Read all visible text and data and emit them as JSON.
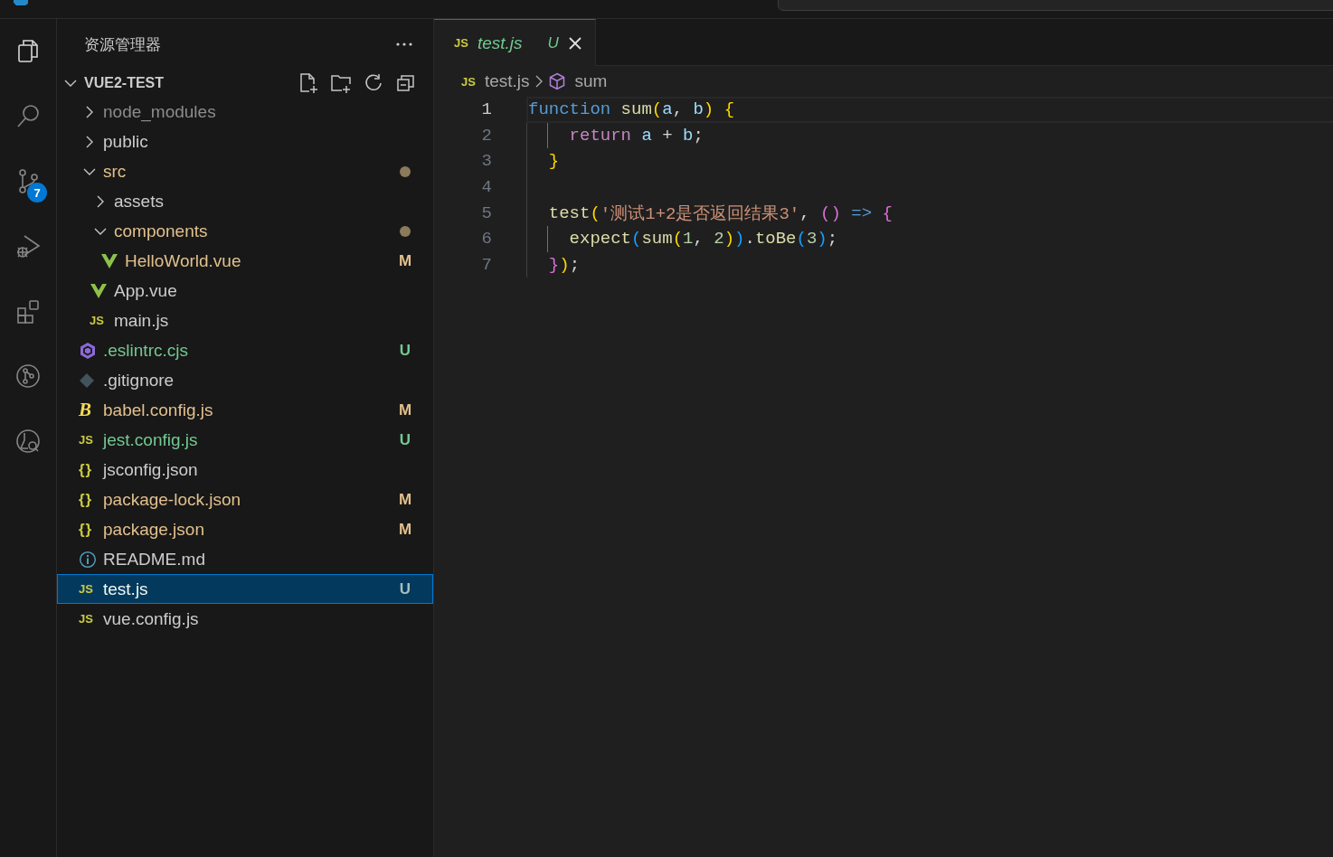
{
  "activity_bar": {
    "items": [
      {
        "kind": "explorer",
        "selected": true
      },
      {
        "kind": "search",
        "selected": false
      },
      {
        "kind": "source-control",
        "selected": false,
        "badge": "7"
      },
      {
        "kind": "run-debug",
        "selected": false
      },
      {
        "kind": "extensions",
        "selected": false
      },
      {
        "kind": "git-graph",
        "selected": false
      },
      {
        "kind": "testing",
        "selected": false
      }
    ]
  },
  "explorer": {
    "title": "资源管理器",
    "root": {
      "name": "VUE2-TEST",
      "expanded": true,
      "children": [
        {
          "name": "node_modules",
          "kind": "folder",
          "expanded": false,
          "ignored": true,
          "modified": false,
          "untracked": false,
          "selected": false
        },
        {
          "name": "public",
          "kind": "folder",
          "expanded": false,
          "ignored": false,
          "modified": false,
          "untracked": false,
          "selected": false
        },
        {
          "name": "src",
          "kind": "folder",
          "expanded": true,
          "ignored": false,
          "modified": true,
          "untracked": false,
          "selected": false,
          "children": [
            {
              "name": "assets",
              "kind": "folder",
              "expanded": false,
              "ignored": false,
              "modified": false,
              "untracked": false,
              "selected": false
            },
            {
              "name": "components",
              "kind": "folder",
              "expanded": true,
              "ignored": false,
              "modified": true,
              "untracked": false,
              "selected": false,
              "children": [
                {
                  "name": "HelloWorld.vue",
                  "kind": "file",
                  "icon": {
                    "kind": "vue"
                  },
                  "ignored": false,
                  "modified": true,
                  "untracked": false,
                  "status": "M",
                  "selected": false
                }
              ]
            },
            {
              "name": "App.vue",
              "kind": "file",
              "icon": {
                "kind": "vue"
              },
              "ignored": false,
              "modified": false,
              "untracked": false,
              "selected": false
            },
            {
              "name": "main.js",
              "kind": "file",
              "icon": {
                "kind": "js",
                "glyph": "JS"
              },
              "ignored": false,
              "modified": false,
              "untracked": false,
              "selected": false
            }
          ]
        },
        {
          "name": ".eslintrc.cjs",
          "kind": "file",
          "icon": {
            "kind": "eslint"
          },
          "ignored": false,
          "modified": false,
          "untracked": true,
          "status": "U",
          "selected": false
        },
        {
          "name": ".gitignore",
          "kind": "file",
          "icon": {
            "kind": "git"
          },
          "ignored": false,
          "modified": false,
          "untracked": false,
          "selected": false
        },
        {
          "name": "babel.config.js",
          "kind": "file",
          "icon": {
            "kind": "babel",
            "glyph": "B"
          },
          "ignored": false,
          "modified": true,
          "untracked": false,
          "status": "M",
          "selected": false
        },
        {
          "name": "jest.config.js",
          "kind": "file",
          "icon": {
            "kind": "js",
            "glyph": "JS"
          },
          "ignored": false,
          "modified": false,
          "untracked": true,
          "status": "U",
          "selected": false
        },
        {
          "name": "jsconfig.json",
          "kind": "file",
          "icon": {
            "kind": "json",
            "glyph": "{}"
          },
          "ignored": false,
          "modified": false,
          "untracked": false,
          "selected": false
        },
        {
          "name": "package-lock.json",
          "kind": "file",
          "icon": {
            "kind": "json",
            "glyph": "{}"
          },
          "ignored": false,
          "modified": true,
          "untracked": false,
          "status": "M",
          "selected": false
        },
        {
          "name": "package.json",
          "kind": "file",
          "icon": {
            "kind": "json",
            "glyph": "{}"
          },
          "ignored": false,
          "modified": true,
          "untracked": false,
          "status": "M",
          "selected": false
        },
        {
          "name": "README.md",
          "kind": "file",
          "icon": {
            "kind": "info"
          },
          "ignored": false,
          "modified": false,
          "untracked": false,
          "selected": false
        },
        {
          "name": "test.js",
          "kind": "file",
          "icon": {
            "kind": "js",
            "glyph": "JS"
          },
          "ignored": false,
          "modified": false,
          "untracked": true,
          "status": "U",
          "selected": true
        },
        {
          "name": "vue.config.js",
          "kind": "file",
          "icon": {
            "kind": "js",
            "glyph": "JS"
          },
          "ignored": false,
          "modified": false,
          "untracked": false,
          "selected": false
        }
      ]
    }
  },
  "editor": {
    "tabs": [
      {
        "icon": {
          "kind": "js",
          "glyph": "JS"
        },
        "label": "test.js",
        "preview": true,
        "untracked": true,
        "status": "U",
        "selected": true
      }
    ],
    "breadcrumbs": [
      {
        "kind": "file",
        "icon": {
          "kind": "js",
          "glyph": "JS"
        },
        "label": "test.js"
      },
      {
        "kind": "symbol",
        "label": "sum"
      }
    ],
    "lines": [
      {
        "number": "1",
        "current": true,
        "tokens": [
          {
            "t": "function",
            "kind": "keyword"
          },
          {
            "t": " sum",
            "kind": "function"
          },
          {
            "t": "(",
            "kind": "bracket1"
          },
          {
            "t": "a",
            "kind": "param"
          },
          {
            "t": ", ",
            "kind": "plain"
          },
          {
            "t": "b",
            "kind": "param"
          },
          {
            "t": ")",
            "kind": "bracket1"
          },
          {
            "t": " {",
            "kind": "bracket1"
          }
        ]
      },
      {
        "number": "2",
        "current": false,
        "tokens": [
          {
            "t": "    return",
            "kind": "control"
          },
          {
            "t": " a",
            "kind": "param"
          },
          {
            "t": " + ",
            "kind": "plain"
          },
          {
            "t": "b",
            "kind": "param"
          },
          {
            "t": ";",
            "kind": "plain"
          }
        ]
      },
      {
        "number": "3",
        "current": false,
        "tokens": [
          {
            "t": "  }",
            "kind": "bracket1"
          }
        ]
      },
      {
        "number": "4",
        "current": false
      },
      {
        "number": "5",
        "current": false,
        "tokens": [
          {
            "t": "  test",
            "kind": "function"
          },
          {
            "t": "(",
            "kind": "bracket1"
          },
          {
            "t": "'测试1+2是否返回结果3'",
            "kind": "string"
          },
          {
            "t": ", ",
            "kind": "plain"
          },
          {
            "t": "()",
            "kind": "bracket2"
          },
          {
            "t": " =>",
            "kind": "keyword"
          },
          {
            "t": " {",
            "kind": "bracket2"
          }
        ]
      },
      {
        "number": "6",
        "current": false,
        "tokens": [
          {
            "t": "    expect",
            "kind": "function"
          },
          {
            "t": "(",
            "kind": "bracket3"
          },
          {
            "t": "sum",
            "kind": "function"
          },
          {
            "t": "(",
            "kind": "bracket1"
          },
          {
            "t": "1",
            "kind": "number"
          },
          {
            "t": ", ",
            "kind": "plain"
          },
          {
            "t": "2",
            "kind": "number"
          },
          {
            "t": ")",
            "kind": "bracket1"
          },
          {
            "t": ")",
            "kind": "bracket3"
          },
          {
            "t": ".",
            "kind": "plain"
          },
          {
            "t": "toBe",
            "kind": "function"
          },
          {
            "t": "(",
            "kind": "bracket3"
          },
          {
            "t": "3",
            "kind": "number"
          },
          {
            "t": ")",
            "kind": "bracket3"
          },
          {
            "t": ";",
            "kind": "plain"
          }
        ]
      },
      {
        "number": "7",
        "current": false,
        "tokens": [
          {
            "t": "  }",
            "kind": "bracket2"
          },
          {
            "t": ")",
            "kind": "bracket1"
          },
          {
            "t": ";",
            "kind": "plain"
          }
        ]
      }
    ]
  }
}
